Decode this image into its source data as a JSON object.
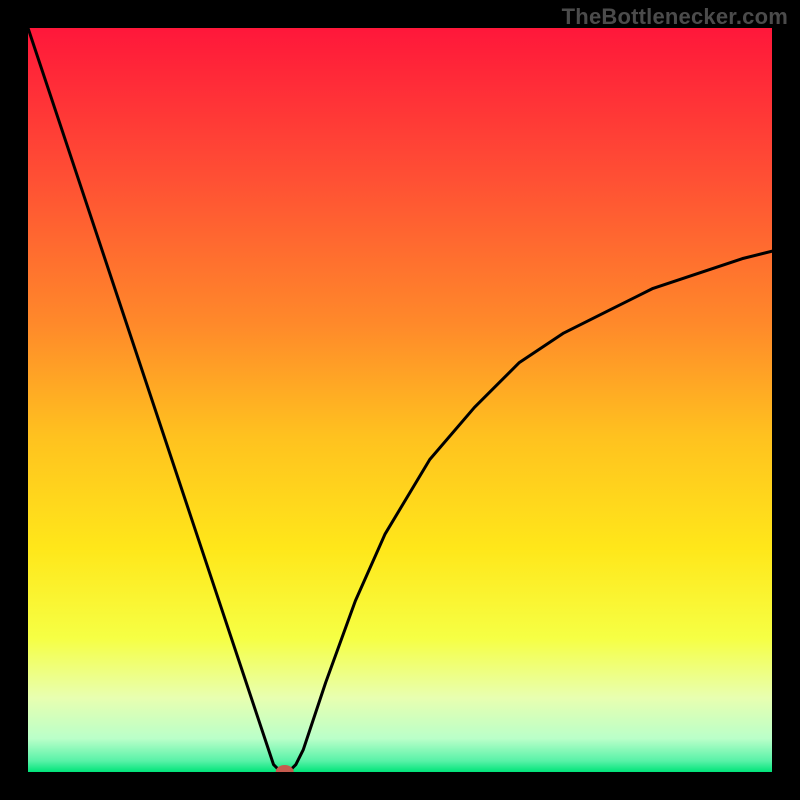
{
  "watermark": "TheBottlenecker.com",
  "chart_data": {
    "type": "line",
    "title": "",
    "xlabel": "",
    "ylabel": "",
    "xlim": [
      0,
      100
    ],
    "ylim": [
      0,
      100
    ],
    "series": [
      {
        "name": "bottleneck-curve",
        "x": [
          0,
          6,
          12,
          18,
          22,
          26,
          29,
          31,
          32,
          33,
          34,
          35,
          36,
          37,
          38,
          40,
          44,
          48,
          54,
          60,
          66,
          72,
          78,
          84,
          90,
          96,
          100
        ],
        "values": [
          100,
          82,
          64,
          46,
          34,
          22,
          13,
          7,
          4,
          1,
          0,
          0,
          1,
          3,
          6,
          12,
          23,
          32,
          42,
          49,
          55,
          59,
          62,
          65,
          67,
          69,
          70
        ]
      }
    ],
    "marker": {
      "x": 34.5,
      "y": 0
    },
    "background_gradient": {
      "stops": [
        {
          "offset": 0.0,
          "color": "#ff173a"
        },
        {
          "offset": 0.2,
          "color": "#ff4f34"
        },
        {
          "offset": 0.4,
          "color": "#ff8a2a"
        },
        {
          "offset": 0.55,
          "color": "#ffc21f"
        },
        {
          "offset": 0.7,
          "color": "#ffe71a"
        },
        {
          "offset": 0.82,
          "color": "#f6ff44"
        },
        {
          "offset": 0.9,
          "color": "#e8ffb0"
        },
        {
          "offset": 0.955,
          "color": "#baffc9"
        },
        {
          "offset": 0.985,
          "color": "#59f2a8"
        },
        {
          "offset": 1.0,
          "color": "#00e47a"
        }
      ]
    }
  }
}
